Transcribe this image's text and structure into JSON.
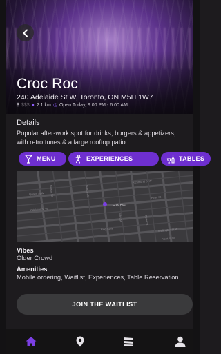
{
  "venue": {
    "name": "Croc Roc",
    "address": "240 Adelaide St W, Toronto, ON M5H 1W7",
    "price_filled": "$",
    "price_empty": "$$$",
    "distance": "2.1 km",
    "hours": "Open Today, 9:00 PM - 6:00 AM"
  },
  "details": {
    "title": "Details",
    "description": "Popular after-work spot for drinks, burgers & appetizers, with retro tunes & a large rooftop patio."
  },
  "actions": {
    "menu": "MENU",
    "experiences": "EXPERIENCES",
    "tables": "TABLES"
  },
  "map": {
    "pin_label": "Croc Roc",
    "streets": [
      "Richmond St W",
      "Queen St W",
      "Adelaide St W",
      "Pearl St",
      "King St W",
      "Wellington St W",
      "Front St W",
      "Nelson St",
      "Duncan St",
      "John St",
      "Peter St"
    ]
  },
  "info": {
    "vibes_label": "Vibes",
    "vibes_value": "Older Crowd",
    "amenities_label": "Amenities",
    "amenities_value": "Mobile ordering, Waitlist, Experiences, Table Reservation"
  },
  "cta": {
    "label": "JOIN THE WAITLIST"
  },
  "tabbar": {
    "active": "home",
    "items": [
      "home-icon",
      "location-pin-icon",
      "list-icon",
      "user-icon"
    ]
  },
  "colors": {
    "accent": "#6e2fd0",
    "active_tab": "#7b3fe4",
    "background": "#1d1b1e"
  }
}
